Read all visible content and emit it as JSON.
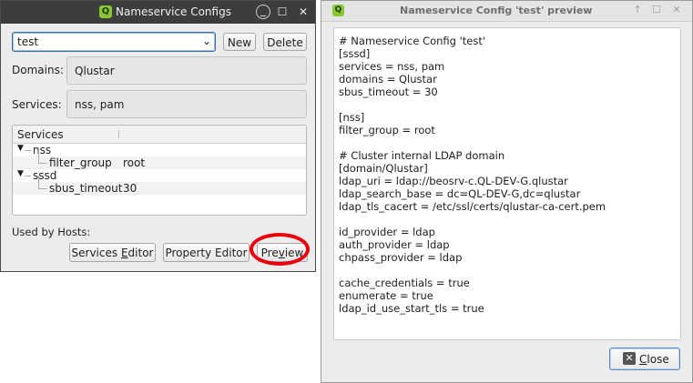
{
  "configs_window": {
    "title": "Nameservice Configs",
    "logo_letter": "Q",
    "config_select": {
      "value": "test"
    },
    "new_label": "New",
    "delete_label": "Delete",
    "domains_label": "Domains:",
    "domains_value": "Qlustar",
    "services_label": "Services:",
    "services_value": "nss, pam",
    "tree": {
      "header": "Services",
      "nodes": [
        {
          "label": "nss",
          "children": [
            {
              "key": "filter_group",
              "value": "root"
            }
          ]
        },
        {
          "label": "sssd",
          "children": [
            {
              "key": "sbus_timeout",
              "value": "30"
            }
          ]
        }
      ]
    },
    "used_by_hosts_label": "Used by Hosts:",
    "services_editor": {
      "pre": "Services ",
      "mnemonic": "E",
      "post": "ditor"
    },
    "property_editor_label": "Property Editor",
    "preview": {
      "pre": "Pre",
      "mnemonic": "v",
      "post": "iew"
    }
  },
  "preview_window": {
    "title": "Nameservice Config 'test' preview",
    "logo_letter": "Q",
    "lines": [
      "# Nameservice Config 'test'",
      "[sssd]",
      "services = nss, pam",
      "domains = Qlustar",
      "sbus_timeout = 30",
      "",
      "[nss]",
      "filter_group = root",
      "",
      "# Cluster internal LDAP domain",
      "[domain/Qlustar]",
      "ldap_uri = ldap://beosrv-c.QL-DEV-G.qlustar",
      "ldap_search_base = dc=QL-DEV-G,dc=qlustar",
      "ldap_tls_cacert = /etc/ssl/certs/qlustar-ca-cert.pem",
      "",
      "id_provider = ldap",
      "auth_provider = ldap",
      "chpass_provider = ldap",
      "",
      "cache_credentials = true",
      "enumerate = true",
      "ldap_id_use_start_tls = true"
    ],
    "close": {
      "mnemonic": "C",
      "post": "lose"
    }
  }
}
